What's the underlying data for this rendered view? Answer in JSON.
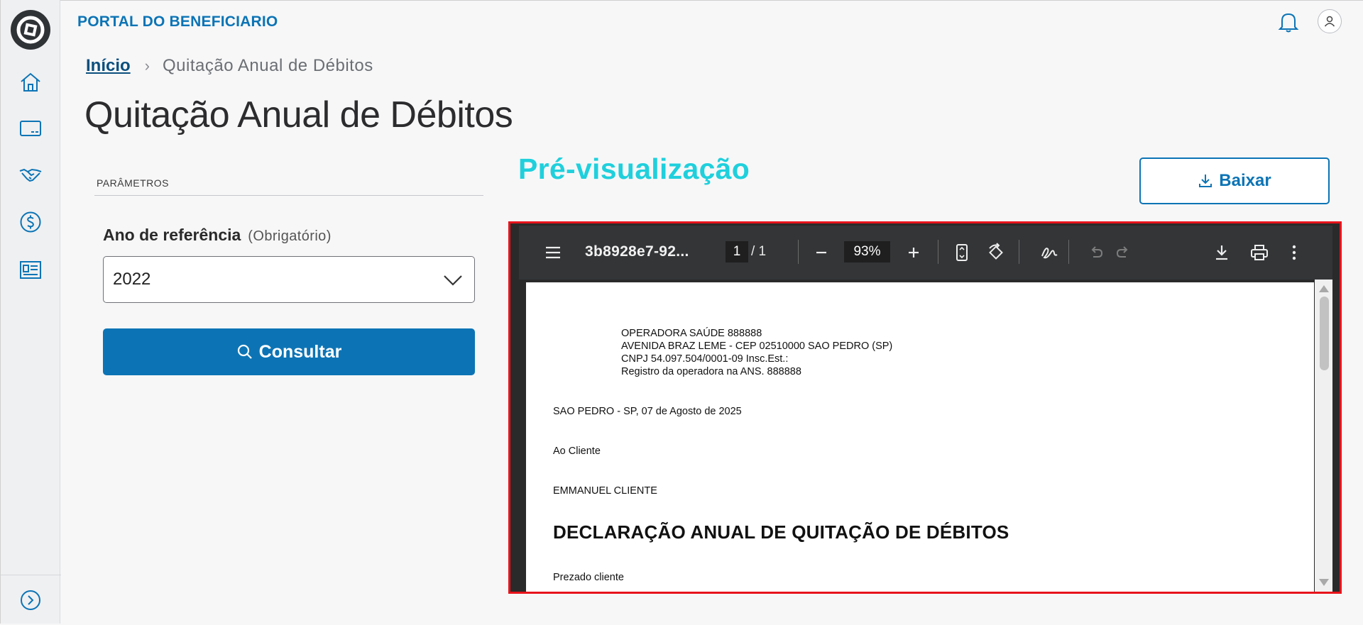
{
  "app": {
    "brand": "PORTAL DO BENEFICIARIO"
  },
  "sidebar": {
    "items": [
      {
        "name": "home-icon"
      },
      {
        "name": "card-icon"
      },
      {
        "name": "handshake-icon"
      },
      {
        "name": "dollar-icon"
      },
      {
        "name": "id-card-icon"
      }
    ],
    "expand_icon": "chevron-right-circle-icon"
  },
  "breadcrumb": {
    "home": "Início",
    "current": "Quitação Anual de Débitos"
  },
  "page": {
    "title": "Quitação Anual de Débitos"
  },
  "params": {
    "section_label": "PARÂMETROS",
    "year_label": "Ano de referência",
    "year_hint": "(Obrigatório)",
    "year_value": "2022",
    "consult_label": "Consultar"
  },
  "preview": {
    "title": "Pré-visualização",
    "download_label": "Baixar"
  },
  "viewer": {
    "doc_name": "3b8928e7-92...",
    "page_current": "1",
    "page_total": "/  1",
    "zoom": "93%"
  },
  "pdf": {
    "lines": [
      "OPERADORA SAÚDE 888888",
      "AVENIDA BRAZ LEME - CEP 02510000 SAO PEDRO (SP)",
      "CNPJ 54.097.504/0001-09  Insc.Est.:",
      "Registro da operadora na ANS. 888888"
    ],
    "place_date": "SAO PEDRO - SP, 07 de Agosto de 2025",
    "salutation": "Ao Cliente",
    "client": "EMMANUEL CLIENTE",
    "heading": "DECLARAÇÃO ANUAL DE QUITAÇÃO DE DÉBITOS",
    "greeting": "Prezado cliente"
  },
  "colors": {
    "brand": "#0c74b5",
    "preview_title": "#1fd0dc",
    "highlight_border": "#e8141b"
  }
}
